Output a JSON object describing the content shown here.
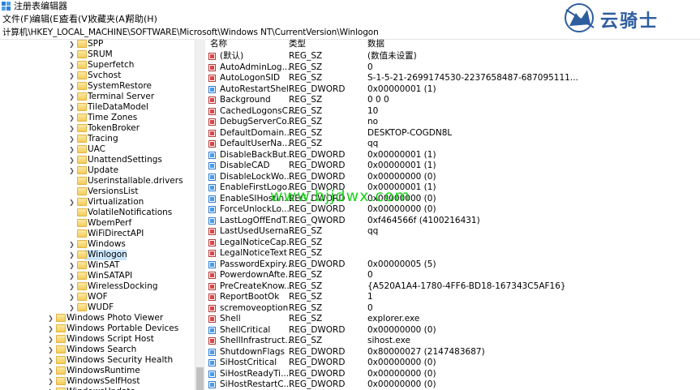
{
  "window": {
    "title": "注册表编辑器"
  },
  "menu": [
    "文件(F)",
    "编辑(E)",
    "查看(V)",
    "收藏夹(A)",
    "帮助(H)"
  ],
  "address": "计算机\\HKEY_LOCAL_MACHINE\\SOFTWARE\\Microsoft\\Windows NT\\CurrentVersion\\Winlogon",
  "tree": {
    "selected": "Winlogon",
    "items": [
      {
        "label": "SPP",
        "expandable": true,
        "level": 2
      },
      {
        "label": "SRUM",
        "expandable": true,
        "level": 2
      },
      {
        "label": "Superfetch",
        "expandable": true,
        "level": 2
      },
      {
        "label": "Svchost",
        "expandable": true,
        "level": 2
      },
      {
        "label": "SystemRestore",
        "expandable": true,
        "level": 2
      },
      {
        "label": "Terminal Server",
        "expandable": true,
        "level": 2
      },
      {
        "label": "TileDataModel",
        "expandable": true,
        "level": 2
      },
      {
        "label": "Time Zones",
        "expandable": true,
        "level": 2
      },
      {
        "label": "TokenBroker",
        "expandable": true,
        "level": 2
      },
      {
        "label": "Tracing",
        "expandable": true,
        "level": 2
      },
      {
        "label": "UAC",
        "expandable": true,
        "level": 2
      },
      {
        "label": "UnattendSettings",
        "expandable": true,
        "level": 2
      },
      {
        "label": "Update",
        "expandable": true,
        "level": 2
      },
      {
        "label": "Userinstallable.drivers",
        "expandable": false,
        "level": 2
      },
      {
        "label": "VersionsList",
        "expandable": false,
        "level": 2
      },
      {
        "label": "Virtualization",
        "expandable": true,
        "level": 2
      },
      {
        "label": "VolatileNotifications",
        "expandable": false,
        "level": 2
      },
      {
        "label": "WbemPerf",
        "expandable": false,
        "level": 2
      },
      {
        "label": "WiFiDirectAPI",
        "expandable": false,
        "level": 2
      },
      {
        "label": "Windows",
        "expandable": true,
        "level": 2
      },
      {
        "label": "Winlogon",
        "expandable": true,
        "level": 2
      },
      {
        "label": "WinSAT",
        "expandable": true,
        "level": 2
      },
      {
        "label": "WinSATAPI",
        "expandable": true,
        "level": 2
      },
      {
        "label": "WirelessDocking",
        "expandable": true,
        "level": 2
      },
      {
        "label": "WOF",
        "expandable": true,
        "level": 2
      },
      {
        "label": "WUDF",
        "expandable": true,
        "level": 2
      },
      {
        "label": "Windows Photo Viewer",
        "expandable": true,
        "level": 1
      },
      {
        "label": "Windows Portable Devices",
        "expandable": true,
        "level": 1
      },
      {
        "label": "Windows Script Host",
        "expandable": true,
        "level": 1
      },
      {
        "label": "Windows Search",
        "expandable": true,
        "level": 1
      },
      {
        "label": "Windows Security Health",
        "expandable": true,
        "level": 1
      },
      {
        "label": "WindowsRuntime",
        "expandable": true,
        "level": 1
      },
      {
        "label": "WindowsSelfHost",
        "expandable": true,
        "level": 1
      },
      {
        "label": "WindowsUpdate",
        "expandable": true,
        "level": 1
      }
    ]
  },
  "columns": {
    "name": "名称",
    "type": "类型",
    "data": "数据"
  },
  "values": [
    {
      "name": "(默认)",
      "type": "REG_SZ",
      "data": "(数值未设置)",
      "kind": "sz"
    },
    {
      "name": "AutoAdminLog...",
      "type": "REG_SZ",
      "data": "0",
      "kind": "sz"
    },
    {
      "name": "AutoLogonSID",
      "type": "REG_SZ",
      "data": "S-1-5-21-2699174530-2237658487-687095111...",
      "kind": "sz"
    },
    {
      "name": "AutoRestartShell",
      "type": "REG_DWORD",
      "data": "0x00000001 (1)",
      "kind": "dw"
    },
    {
      "name": "Background",
      "type": "REG_SZ",
      "data": "0 0 0",
      "kind": "sz"
    },
    {
      "name": "CachedLogonsC...",
      "type": "REG_SZ",
      "data": "10",
      "kind": "sz"
    },
    {
      "name": "DebugServerCo...",
      "type": "REG_SZ",
      "data": "no",
      "kind": "sz"
    },
    {
      "name": "DefaultDomain...",
      "type": "REG_SZ",
      "data": "DESKTOP-COGDN8L",
      "kind": "sz"
    },
    {
      "name": "DefaultUserNa...",
      "type": "REG_SZ",
      "data": "qq",
      "kind": "sz"
    },
    {
      "name": "DisableBackBut...",
      "type": "REG_DWORD",
      "data": "0x00000001 (1)",
      "kind": "dw"
    },
    {
      "name": "DisableCAD",
      "type": "REG_DWORD",
      "data": "0x00000001 (1)",
      "kind": "dw"
    },
    {
      "name": "DisableLockWo...",
      "type": "REG_DWORD",
      "data": "0x00000000 (0)",
      "kind": "dw"
    },
    {
      "name": "EnableFirstLogo...",
      "type": "REG_DWORD",
      "data": "0x00000001 (1)",
      "kind": "dw"
    },
    {
      "name": "EnableSIHostIn...",
      "type": "REG_DWORD",
      "data": "0x00000000 (0)",
      "kind": "dw"
    },
    {
      "name": "ForceUnlockLo...",
      "type": "REG_DWORD",
      "data": "0x00000000 (0)",
      "kind": "dw"
    },
    {
      "name": "LastLogOffEndT...",
      "type": "REG_QWORD",
      "data": "0xf464566f (4100216431)",
      "kind": "dw"
    },
    {
      "name": "LastUsedUserna...",
      "type": "REG_SZ",
      "data": "qq",
      "kind": "sz"
    },
    {
      "name": "LegalNoticeCap...",
      "type": "REG_SZ",
      "data": "",
      "kind": "sz"
    },
    {
      "name": "LegalNoticeText",
      "type": "REG_SZ",
      "data": "",
      "kind": "sz"
    },
    {
      "name": "PasswordExpiry...",
      "type": "REG_DWORD",
      "data": "0x00000005 (5)",
      "kind": "dw"
    },
    {
      "name": "PowerdownAfte...",
      "type": "REG_SZ",
      "data": "0",
      "kind": "sz"
    },
    {
      "name": "PreCreateKnow...",
      "type": "REG_SZ",
      "data": "{A520A1A4-1780-4FF6-BD18-167343C5AF16}",
      "kind": "sz"
    },
    {
      "name": "ReportBootOk",
      "type": "REG_SZ",
      "data": "1",
      "kind": "sz"
    },
    {
      "name": "scremoveoption",
      "type": "REG_SZ",
      "data": "0",
      "kind": "sz"
    },
    {
      "name": "Shell",
      "type": "REG_SZ",
      "data": "explorer.exe",
      "kind": "sz"
    },
    {
      "name": "ShellCritical",
      "type": "REG_DWORD",
      "data": "0x00000000 (0)",
      "kind": "dw"
    },
    {
      "name": "ShellInfrastruct...",
      "type": "REG_SZ",
      "data": "sihost.exe",
      "kind": "sz"
    },
    {
      "name": "ShutdownFlags",
      "type": "REG_DWORD",
      "data": "0x80000027 (2147483687)",
      "kind": "dw"
    },
    {
      "name": "SiHostCritical",
      "type": "REG_DWORD",
      "data": "0x00000000 (0)",
      "kind": "dw"
    },
    {
      "name": "SiHostReadyTi...",
      "type": "REG_DWORD",
      "data": "0x00000000 (0)",
      "kind": "dw"
    },
    {
      "name": "SiHostRestartC...",
      "type": "REG_DWORD",
      "data": "0x00000000 (0)",
      "kind": "dw"
    }
  ],
  "watermark": "www.bjjdwx.com",
  "logo": {
    "text": "云骑士"
  }
}
